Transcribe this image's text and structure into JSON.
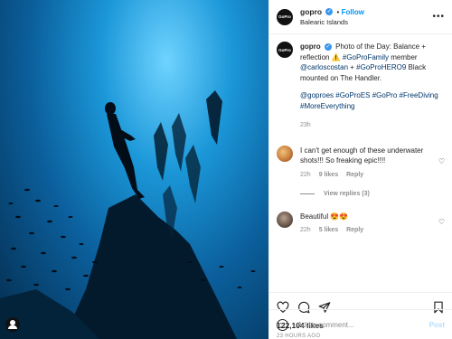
{
  "post": {
    "header": {
      "avatar_text": "GoPro",
      "username": "gopro",
      "follow_label": "Follow",
      "separator": "•",
      "location": "Balearic Islands",
      "more_label": "•••"
    },
    "caption": {
      "username": "gopro",
      "text_before": "Photo of the Day: Balance + reflection ",
      "warning_emoji": "⚠️",
      "text_hashtag1": " #GoProFamily",
      "text_member": " member ",
      "mention": "@carloscostan",
      "text_plus": " + ",
      "hashtag2": "#GoProHERO9",
      "text_after": " Black mounted on The Handler.",
      "hashtags_line": "@goproes #GoProES #GoPro #FreeDiving #MoreEverything",
      "time": "23h"
    },
    "comments": [
      {
        "text": "I can't get enough of these underwater shots!!! So freaking epic!!!!",
        "time": "22h",
        "likes": "9 likes",
        "reply_label": "Reply",
        "view_replies": "View replies (3)"
      },
      {
        "text": "Beautiful 😍😍",
        "time": "22h",
        "likes": "5 likes",
        "reply_label": "Reply"
      }
    ],
    "likes": "122,104 likes",
    "timestamp": "23 HOURS AGO",
    "add_comment": {
      "placeholder": "Add a comment...",
      "post_label": "Post"
    }
  },
  "colors": {
    "link": "#00376b",
    "follow": "#0095f6",
    "post_disabled": "#b2dffc",
    "muted": "#8e8e8e"
  }
}
